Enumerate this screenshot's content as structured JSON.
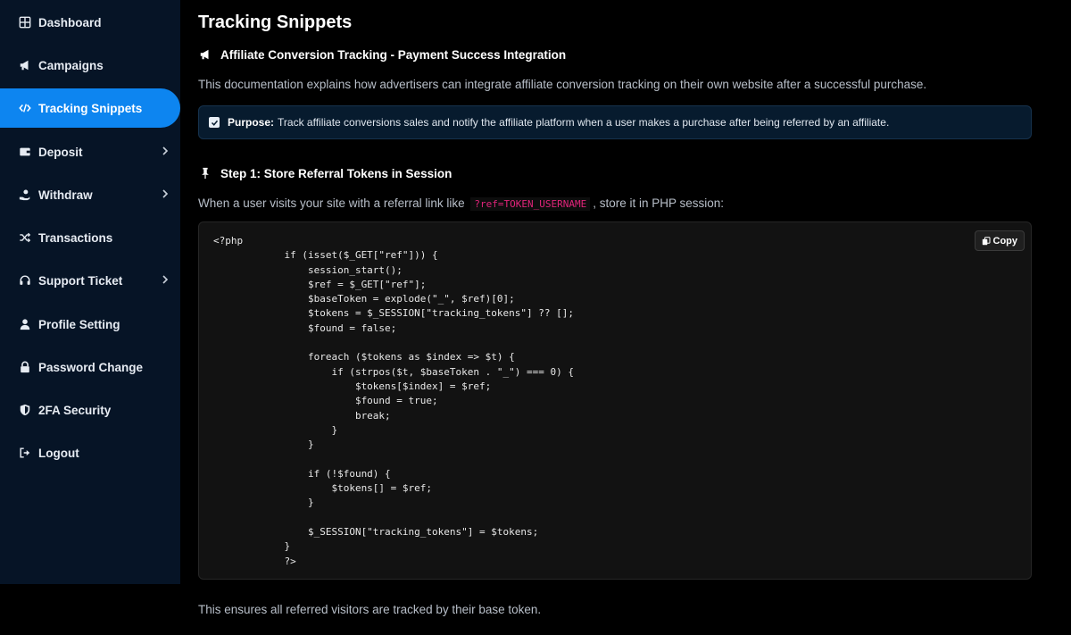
{
  "sidebar": {
    "items": [
      {
        "label": "Dashboard",
        "icon": "grid-icon"
      },
      {
        "label": "Campaigns",
        "icon": "megaphone-icon"
      },
      {
        "label": "Tracking Snippets",
        "icon": "code-icon",
        "active": true
      },
      {
        "label": "Deposit",
        "icon": "wallet-icon",
        "submenu": true
      },
      {
        "label": "Withdraw",
        "icon": "hand-coin-icon",
        "submenu": true
      },
      {
        "label": "Transactions",
        "icon": "shuffle-icon"
      },
      {
        "label": "Support Ticket",
        "icon": "headset-icon",
        "submenu": true
      },
      {
        "label": "Profile Setting",
        "icon": "user-icon"
      },
      {
        "label": "Password Change",
        "icon": "lock-icon"
      },
      {
        "label": "2FA Security",
        "icon": "shield-icon"
      },
      {
        "label": "Logout",
        "icon": "logout-icon"
      }
    ]
  },
  "page": {
    "title": "Tracking Snippets",
    "section_heading": "Affiliate Conversion Tracking - Payment Success Integration",
    "intro": "This documentation explains how advertisers can integrate affiliate conversion tracking on their own website after a successful purchase.",
    "purpose_label": "Purpose:",
    "purpose_text": "Track affiliate conversions sales and notify the affiliate platform when a user makes a purchase after being referred by an affiliate.",
    "step1_heading": "Step 1: Store Referral Tokens in Session",
    "step1_text_before": "When a user visits your site with a referral link like",
    "step1_code": "?ref=TOKEN_USERNAME",
    "step1_text_after": ", store it in PHP session:",
    "copy_label": "Copy",
    "code": "<?php\n            if (isset($_GET[\"ref\"])) {\n                session_start();\n                $ref = $_GET[\"ref\"];\n                $baseToken = explode(\"_\", $ref)[0];\n                $tokens = $_SESSION[\"tracking_tokens\"] ?? [];\n                $found = false;\n\n                foreach ($tokens as $index => $t) {\n                    if (strpos($t, $baseToken . \"_\") === 0) {\n                        $tokens[$index] = $ref;\n                        $found = true;\n                        break;\n                    }\n                }\n\n                if (!$found) {\n                    $tokens[] = $ref;\n                }\n\n                $_SESSION[\"tracking_tokens\"] = $tokens;\n            }\n            ?>",
    "footer_text": "This ensures all referred visitors are tracked by their base token."
  }
}
